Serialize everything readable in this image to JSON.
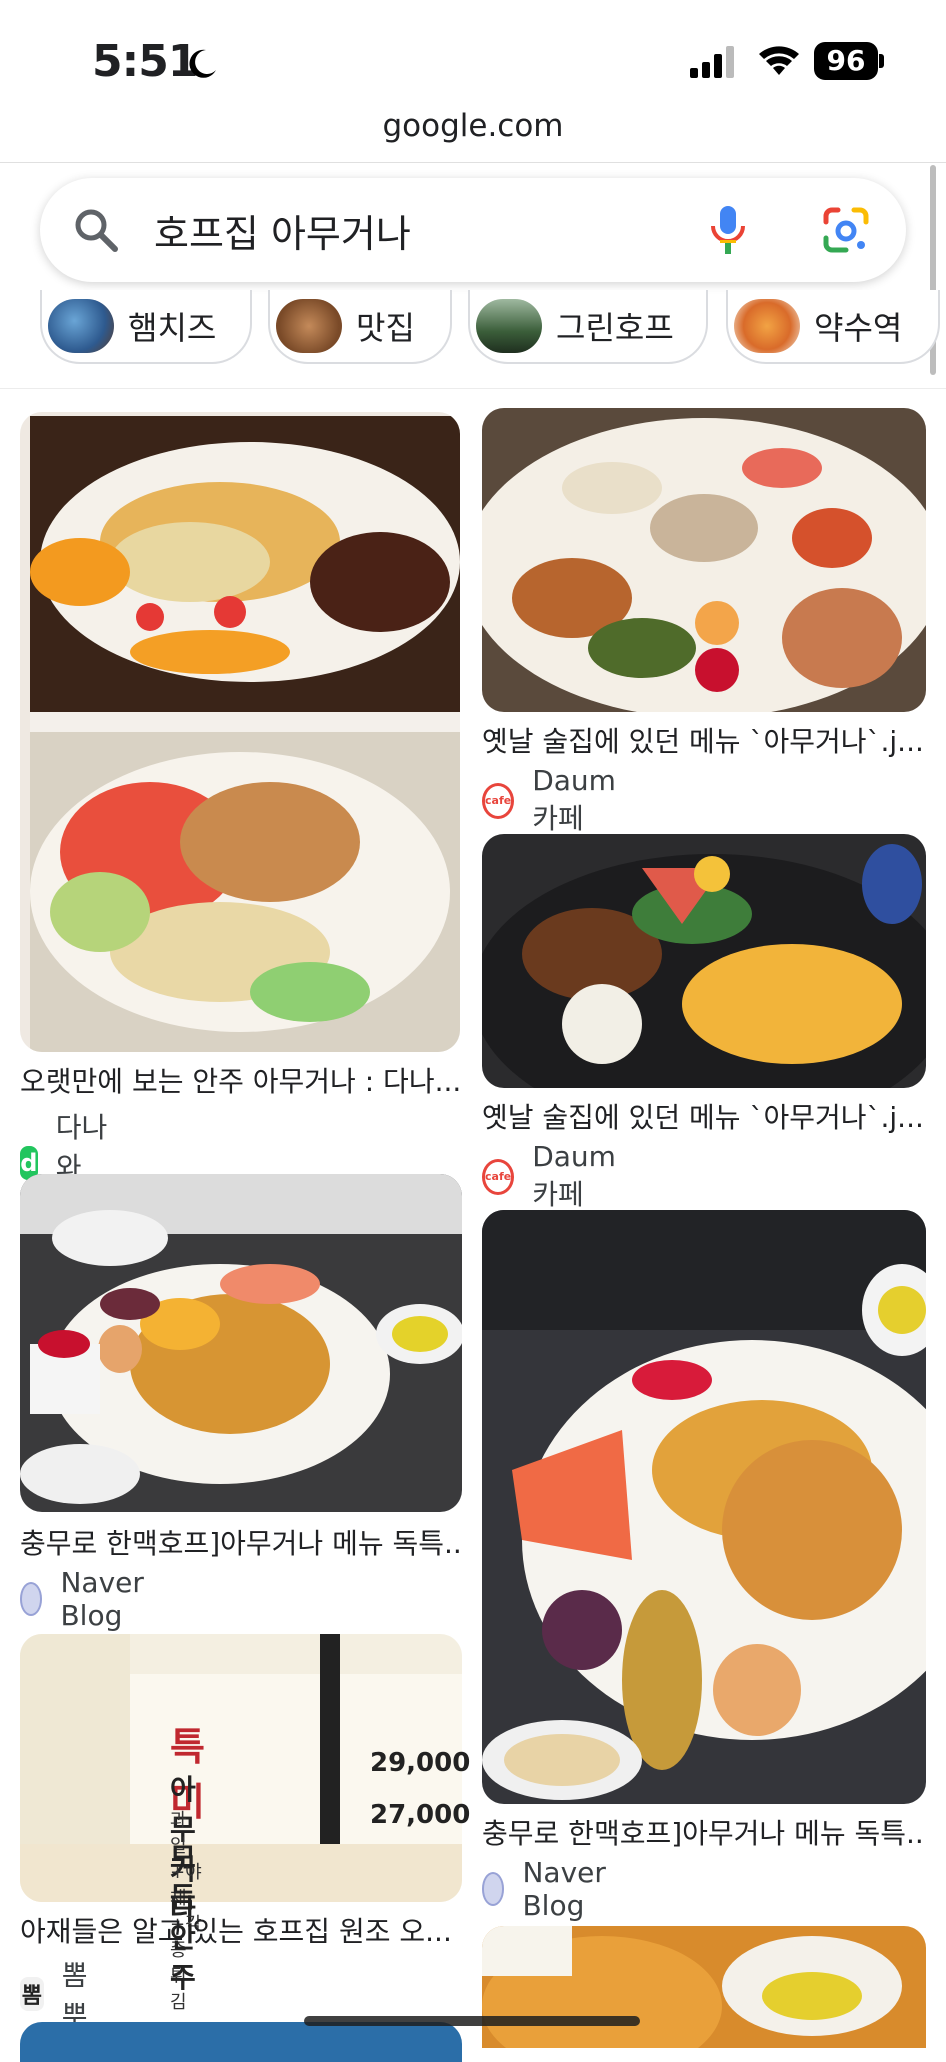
{
  "status": {
    "time": "5:51",
    "battery": "96"
  },
  "browser": {
    "url": "google.com"
  },
  "search": {
    "query": "호프집 아무거나"
  },
  "chips": [
    {
      "label": "햄치즈"
    },
    {
      "label": "맛집"
    },
    {
      "label": "그린호프"
    },
    {
      "label": "약수역"
    }
  ],
  "results": [
    {
      "caption": "오랫만에 보는 안주 아무거나 : 다나...",
      "source": "다나와 DPG",
      "favicon": "d"
    },
    {
      "caption": "옛날 술집에 있던 메뉴 `아무거나`.j...",
      "source": "Daum 카페",
      "favicon": "cafe"
    },
    {
      "caption": "옛날 술집에 있던 메뉴 `아무거나`.j...",
      "source": "Daum 카페",
      "favicon": "cafe"
    },
    {
      "caption": "충무로 한맥호프]아무거나 메뉴 독특...",
      "source": "Naver Blog"
    },
    {
      "caption": "충무로 한맥호프]아무거나 메뉴 독특...",
      "source": "Naver Blog"
    },
    {
      "caption": "아재들은 알고 있는 호프집 원조 오...",
      "source": "뽐뿌",
      "favicon": "뽐"
    }
  ],
  "menu_image": {
    "lines": [
      "특 미",
      "아 무 거 나",
      "과일+야채+각종튀김",
      "모듬안주"
    ],
    "prices": [
      "29,000",
      "27,000"
    ]
  },
  "colors": {
    "accent_blue": "#4285f4",
    "red": "#ea4335",
    "yellow": "#fbbc04",
    "green": "#34a853"
  }
}
